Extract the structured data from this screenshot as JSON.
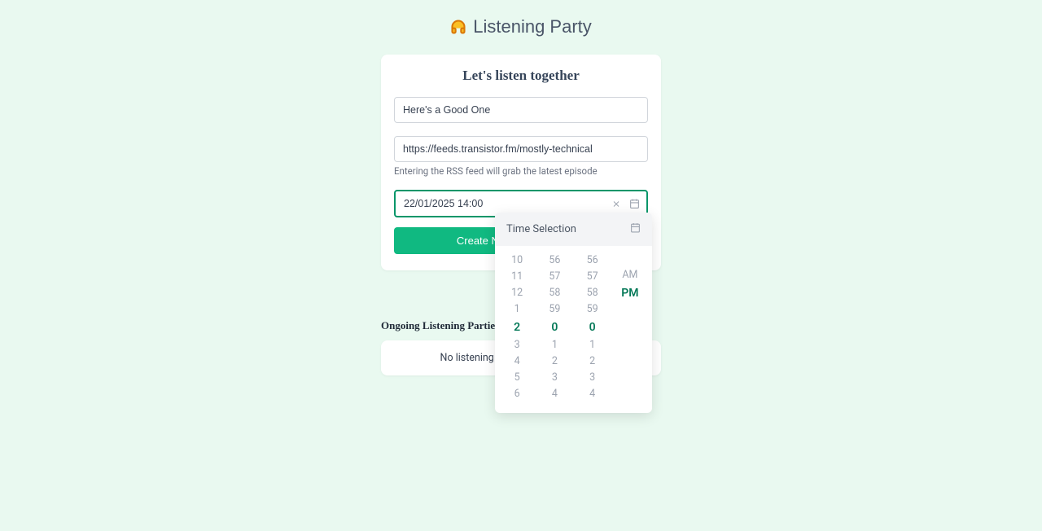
{
  "logo": {
    "text": "Listening Party"
  },
  "card": {
    "title": "Let's listen together",
    "episode_name": "Here's a Good One",
    "rss_url": "https://feeds.transistor.fm/mostly-technical",
    "rss_helper": "Entering the RSS feed will grab the latest episode",
    "datetime_value": "22/01/2025 14:00",
    "create_button": "Create New Listening Party"
  },
  "time_picker": {
    "header": "Time Selection",
    "hours": [
      "10",
      "11",
      "12",
      "1",
      "2",
      "3",
      "4",
      "5",
      "6"
    ],
    "hours_selected_index": 4,
    "minutes": [
      "56",
      "57",
      "58",
      "59",
      "0",
      "1",
      "2",
      "3",
      "4"
    ],
    "minutes_selected_index": 4,
    "seconds": [
      "56",
      "57",
      "58",
      "59",
      "0",
      "1",
      "2",
      "3",
      "4"
    ],
    "seconds_selected_index": 4,
    "ampm": [
      "",
      "",
      "",
      "AM",
      "PM",
      "",
      "",
      "",
      ""
    ],
    "ampm_selected_index": 4
  },
  "ongoing": {
    "title": "Ongoing Listening Parties",
    "empty_text": "No listening parties started yet... 😿"
  }
}
